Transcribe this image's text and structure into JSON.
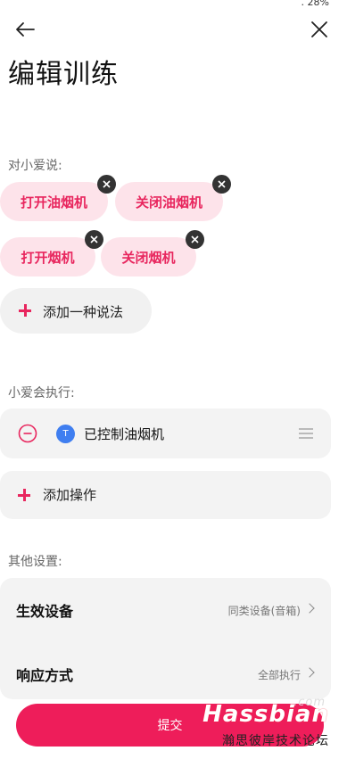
{
  "status": {
    "battery_partial": "⁚ 28%"
  },
  "header": {
    "title": "编辑训练"
  },
  "utterances": {
    "section_label": "对小爱说:",
    "items": [
      "打开油烟机",
      "关闭油烟机",
      "打开烟机",
      "关闭烟机"
    ],
    "add_label": "添加一种说法"
  },
  "actions": {
    "section_label": "小爱会执行:",
    "items": [
      {
        "badge": "T",
        "label": "已控制油烟机"
      }
    ],
    "add_label": "添加操作"
  },
  "other_settings": {
    "section_label": "其他设置:",
    "rows": [
      {
        "label": "生效设备",
        "value": "同类设备(音箱)"
      },
      {
        "label": "响应方式",
        "value": "全部执行"
      }
    ]
  },
  "submit_label": "提交",
  "watermark": {
    "top": ".com",
    "main": "Hassbian",
    "sub": "瀚思彼岸技术论坛"
  },
  "colors": {
    "accent": "#ee1d5a",
    "chip_bg": "#fde3ea",
    "card_bg": "#f3f3f3",
    "badge_blue": "#3f7ef0"
  }
}
